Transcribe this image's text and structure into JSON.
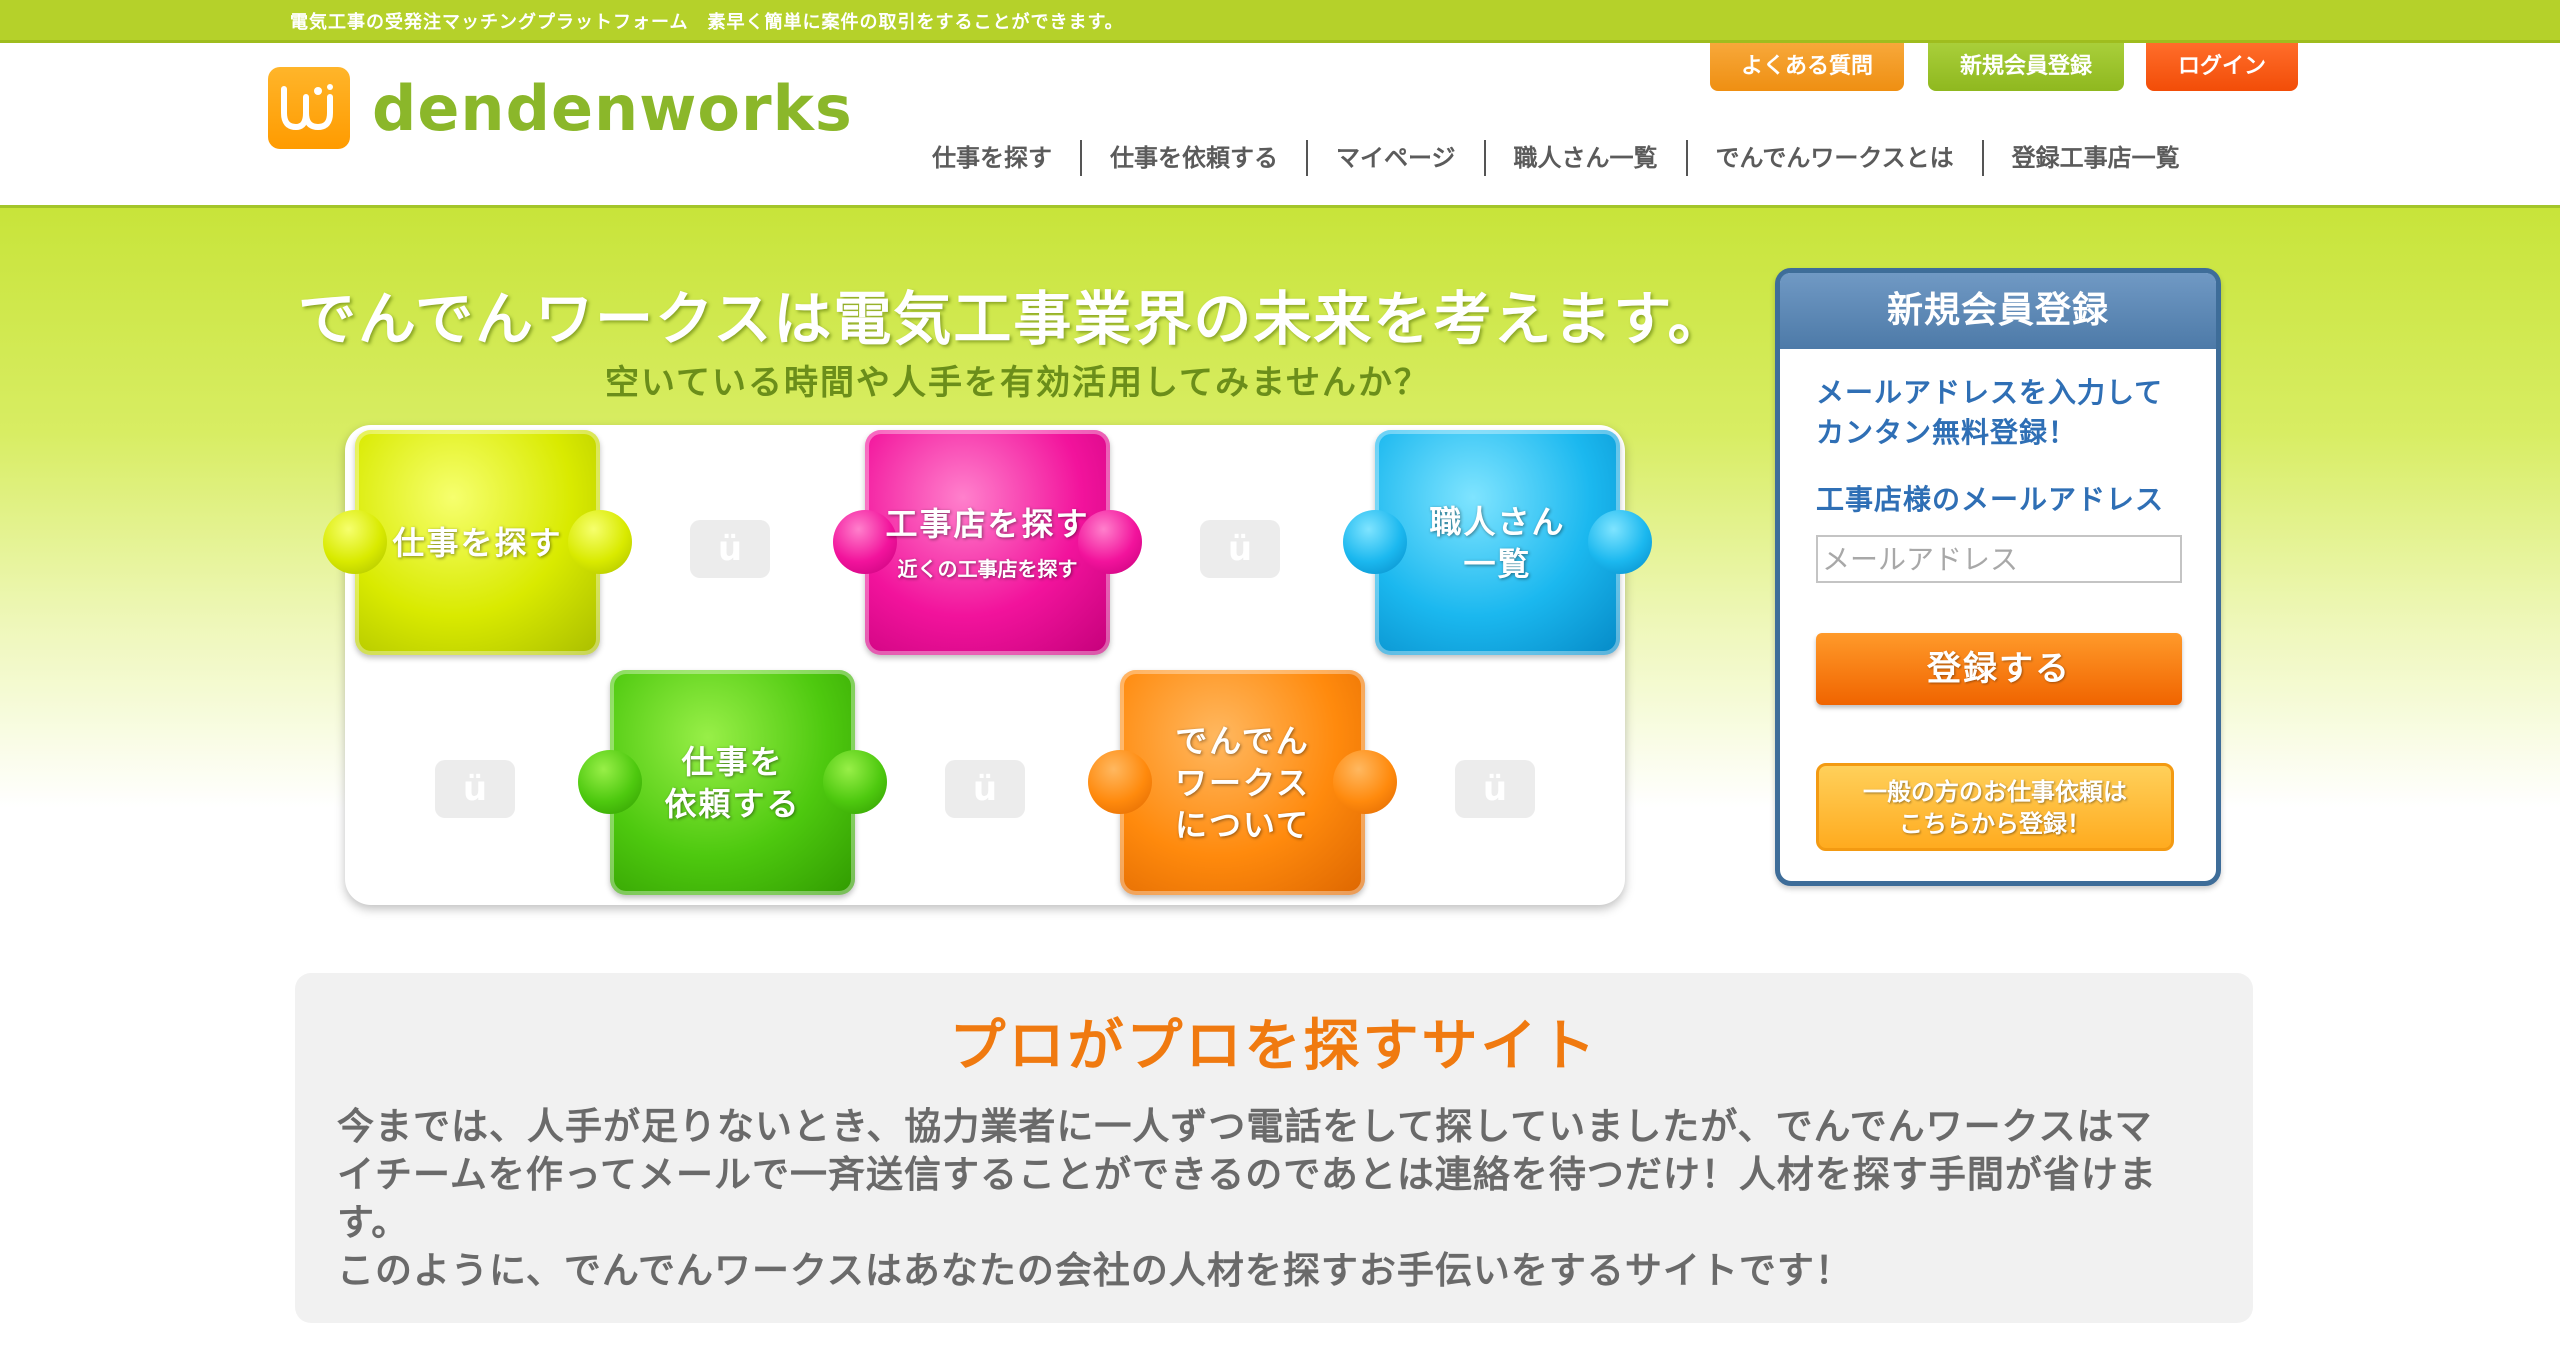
{
  "topbar": {
    "tagline": "電気工事の受発注マッチングプラットフォーム　素早く簡単に案件の取引をすることができます。"
  },
  "header": {
    "utility": {
      "faq": "よくある質問",
      "register": "新規会員登録",
      "login": "ログイン"
    },
    "logo_text": "dendenworks",
    "nav": [
      {
        "label": "仕事を探す"
      },
      {
        "label": "仕事を依頼する"
      },
      {
        "label": "マイページ"
      },
      {
        "label": "職人さん一覧"
      },
      {
        "label": "でんでんワークスとは"
      },
      {
        "label": "登録工事店一覧"
      }
    ]
  },
  "hero": {
    "title": "でんでんワークスは電気工事業界の未来を考えます。",
    "subtitle": "空いている時間や人手を有効活用してみませんか？",
    "pieces": {
      "find_job": "仕事を探す",
      "find_shop_main": "工事店を探す",
      "find_shop_sub": "近くの工事店を探す",
      "craftsmen_line1": "職人さん",
      "craftsmen_line2": "一覧",
      "request_line1": "仕事を",
      "request_line2": "依頼する",
      "about_line1": "でんでん",
      "about_line2": "ワークス",
      "about_line3": "について"
    }
  },
  "signup": {
    "heading": "新規会員登録",
    "lead_line1": "メールアドレスを入力して",
    "lead_line2": "カンタン無料登録！",
    "email_label": "工事店様のメールアドレス",
    "email_placeholder": "メールアドレス",
    "email_value": "",
    "submit_label": "登録する",
    "general_line1": "一般の方のお仕事依頼は",
    "general_line2": "こちらから登録！"
  },
  "intro": {
    "title": "プロがプロを探すサイト",
    "para1": "今までは、人手が足りないとき、協力業者に一人ずつ電話をして探していましたが、でんでんワークスはマイチームを作ってメールで一斉送信することができるのであとは連絡を待つだけ！人材を探す手間が省けます。",
    "para2": "このように、でんでんワークスはあなたの会社の人材を探すお手伝いをするサイトです！"
  },
  "colors": {
    "brand_green": "#b5d12a",
    "logo_orange": "#ff9b00",
    "accent_orange": "#f07a10",
    "panel_blue": "#3e6d99"
  }
}
